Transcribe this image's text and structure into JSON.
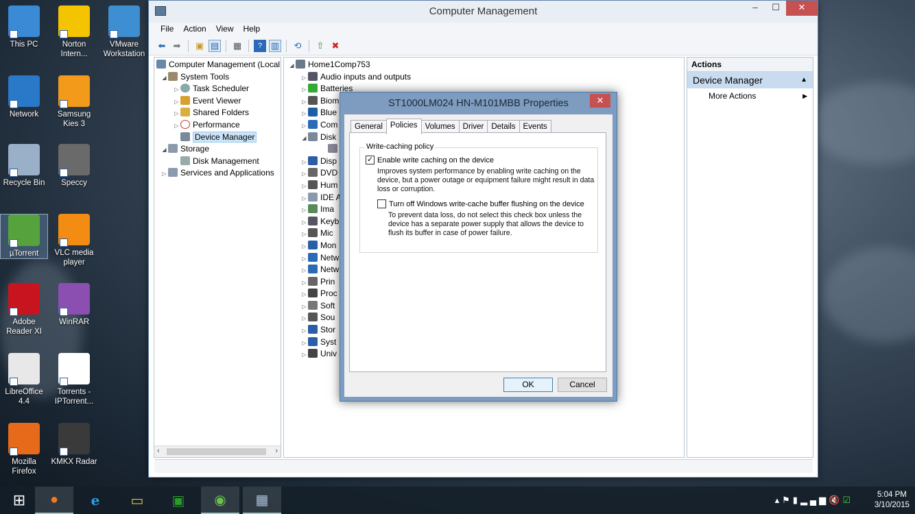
{
  "desktop_icons": [
    {
      "label": "This PC",
      "icon": "pc-icon",
      "color": "#3a8ad6"
    },
    {
      "label": "Norton Intern...",
      "icon": "norton-icon",
      "color": "#f5c400"
    },
    {
      "label": "VMware Workstation",
      "icon": "vmware-icon",
      "color": "#3d8fd1"
    },
    {
      "label": "Network",
      "icon": "network-icon",
      "color": "#2a78c8"
    },
    {
      "label": "Samsung Kies 3",
      "icon": "kies-icon",
      "color": "#f39a1a"
    },
    {
      "label": "Recycle Bin",
      "icon": "recycle-bin-icon",
      "color": "#9ab0c8"
    },
    {
      "label": "Speccy",
      "icon": "speccy-icon",
      "color": "#6a6a6a"
    },
    {
      "label": "µTorrent",
      "icon": "utorrent-icon",
      "color": "#56a33e"
    },
    {
      "label": "VLC media player",
      "icon": "vlc-icon",
      "color": "#f28c13"
    },
    {
      "label": "Adobe Reader XI",
      "icon": "adobe-reader-icon",
      "color": "#c8141e"
    },
    {
      "label": "WinRAR",
      "icon": "winrar-icon",
      "color": "#8a4fb0"
    },
    {
      "label": "LibreOffice 4.4",
      "icon": "libreoffice-icon",
      "color": "#e8e8e8"
    },
    {
      "label": "Torrents - IPTorrent...",
      "icon": "iptorrents-icon",
      "color": "#ffffff"
    },
    {
      "label": "Mozilla Firefox",
      "icon": "firefox-icon",
      "color": "#e66a1a"
    },
    {
      "label": "KMKX Radar",
      "icon": "radar-icon",
      "color": "#3a3a3a"
    }
  ],
  "window": {
    "title": "Computer Management",
    "controls": {
      "minimize": "–",
      "maximize": "☐",
      "close": "✕"
    }
  },
  "menu": [
    "File",
    "Action",
    "View",
    "Help"
  ],
  "left_tree": {
    "root": "Computer Management (Local",
    "system_tools": "System Tools",
    "task_scheduler": "Task Scheduler",
    "event_viewer": "Event Viewer",
    "shared_folders": "Shared Folders",
    "performance": "Performance",
    "device_manager": "Device Manager",
    "storage": "Storage",
    "disk_management": "Disk Management",
    "services": "Services and Applications"
  },
  "device_tree": {
    "root": "Home1Comp753",
    "items": [
      "Audio inputs and outputs",
      "Batteries",
      "Biom",
      "Blue",
      "Com",
      "Disk",
      "",
      "Disp",
      "DVD",
      "Hum",
      "IDE A",
      "Ima",
      "Keyb",
      "Mic",
      "Mon",
      "Netw",
      "Netw",
      "Prin",
      "Proc",
      "Soft",
      "Sou",
      "Stor",
      "Syst",
      "Univ"
    ]
  },
  "actions": {
    "header": "Actions",
    "group": "Device Manager",
    "more": "More Actions"
  },
  "dialog": {
    "title": "ST1000LM024 HN-M101MBB Properties",
    "close": "✕",
    "tabs": [
      "General",
      "Policies",
      "Volumes",
      "Driver",
      "Details",
      "Events"
    ],
    "active_tab": "Policies",
    "group_label": "Write-caching policy",
    "option1_label": "Enable write caching on the device",
    "option1_checked": true,
    "option1_desc_1": "Improves system performance by enabling write caching on the",
    "option1_desc_2": "device, but a power outage or equipment failure might result in data",
    "option1_desc_3": "loss or corruption.",
    "option2_label": "Turn off Windows write-cache buffer flushing on the device",
    "option2_checked": false,
    "option2_desc_1": "To prevent data loss, do not select this check box unless the",
    "option2_desc_2": "device has a separate power supply that allows the device to",
    "option2_desc_3": "flush its buffer in case of power failure.",
    "ok": "OK",
    "cancel": "Cancel"
  },
  "taskbar": {
    "time": "5:04 PM",
    "date": "3/10/2015"
  }
}
